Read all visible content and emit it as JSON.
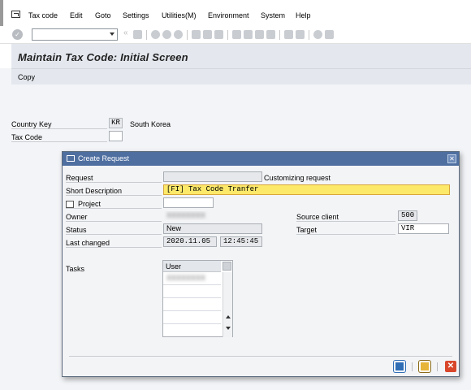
{
  "menu": {
    "items": [
      "Tax code",
      "Edit",
      "Goto",
      "Settings",
      "Utilities(M)",
      "Environment",
      "System",
      "Help"
    ],
    "underlines": [
      "T",
      "E",
      "G",
      "S",
      "M",
      "r",
      "S",
      "H"
    ]
  },
  "screen": {
    "title": "Maintain Tax Code: Initial Screen",
    "toolbar_button": "Copy"
  },
  "form": {
    "country_key_label": "Country Key",
    "country_key_value": "KR",
    "country_name": "South Korea",
    "tax_code_label": "Tax Code",
    "tax_code_value": ""
  },
  "dialog": {
    "title": "Create Request",
    "request_label": "Request",
    "request_value": "",
    "request_type": "Customizing request",
    "short_desc_label": "Short Description",
    "short_desc_value": "[FI] Tax Code Tranfer",
    "project_label": "Project",
    "project_value": "",
    "owner_label": "Owner",
    "owner_value": "XXXXXXXX",
    "status_label": "Status",
    "status_value": "New",
    "last_changed_label": "Last changed",
    "last_changed_date": "2020.11.05",
    "last_changed_time": "12:45:45",
    "source_client_label": "Source client",
    "source_client_value": "500",
    "target_label": "Target",
    "target_value": "VIR",
    "tasks_label": "Tasks",
    "tasks_header": "User",
    "tasks_rows": [
      "XXXXXXXX",
      "",
      "",
      "",
      ""
    ]
  },
  "colors": {
    "title_bar": "#4f6fa0",
    "highlight": "#fce96a",
    "save_btn": "#2f6db5",
    "cancel_btn": "#d9472b"
  }
}
